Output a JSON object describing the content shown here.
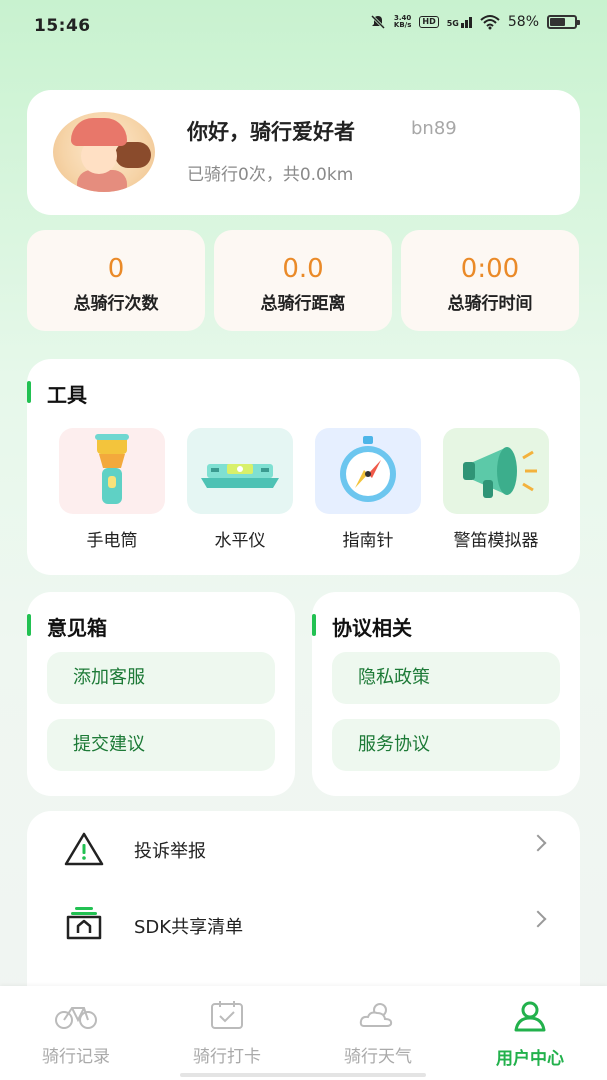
{
  "status_bar": {
    "time": "15:46",
    "net_speed_value": "3.40",
    "net_speed_unit": "KB/s",
    "hd_label": "HD",
    "network": "5G",
    "battery": "58%"
  },
  "profile": {
    "greeting": "你好，骑行爱好者",
    "username": "bn89",
    "summary": "已骑行0次，共0.0km"
  },
  "stats": [
    {
      "value": "0",
      "label": "总骑行次数"
    },
    {
      "value": "0.0",
      "label": "总骑行距离"
    },
    {
      "value": "0:00",
      "label": "总骑行时间"
    }
  ],
  "tools": {
    "title": "工具",
    "items": [
      {
        "label": "手电筒",
        "icon": "flashlight-icon"
      },
      {
        "label": "水平仪",
        "icon": "level-icon"
      },
      {
        "label": "指南针",
        "icon": "compass-icon"
      },
      {
        "label": "警笛模拟器",
        "icon": "megaphone-icon"
      }
    ]
  },
  "feedback": {
    "title": "意见箱",
    "items": [
      "添加客服",
      "提交建议"
    ]
  },
  "agreements": {
    "title": "协议相关",
    "items": [
      "隐私政策",
      "服务协议"
    ]
  },
  "menu": [
    {
      "label": "投诉举报",
      "icon": "warning-icon"
    },
    {
      "label": "SDK共享清单",
      "icon": "share-list-icon"
    }
  ],
  "bottom_nav": [
    {
      "label": "骑行记录",
      "icon": "bike-icon",
      "active": false
    },
    {
      "label": "骑行打卡",
      "icon": "calendar-check-icon",
      "active": false
    },
    {
      "label": "骑行天气",
      "icon": "weather-icon",
      "active": false
    },
    {
      "label": "用户中心",
      "icon": "user-icon",
      "active": true
    }
  ],
  "colors": {
    "accent": "#22c152",
    "stat_value": "#ea8a28",
    "pill_text": "#1d7a37"
  }
}
